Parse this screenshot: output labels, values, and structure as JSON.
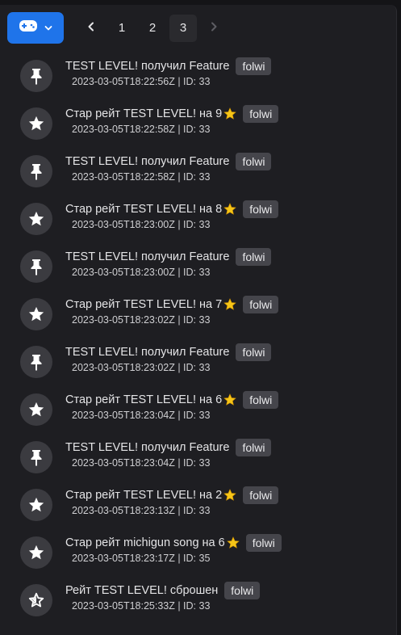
{
  "toolbar": {
    "game_icon": "gamepad-icon",
    "dropdown_icon": "chevron-down-icon",
    "accent": "#1f74ea"
  },
  "pagination": {
    "prev_icon": "chevron-left-icon",
    "next_icon": "chevron-right-icon",
    "pages": [
      "1",
      "2",
      "3"
    ],
    "current": "3"
  },
  "events": [
    {
      "kind": "feature",
      "icon": "pin-icon",
      "message": "TEST LEVEL! получил Feature",
      "star": false,
      "user": "folwi",
      "meta": "2023-03-05T18:22:56Z | ID: 33"
    },
    {
      "kind": "rate",
      "icon": "star-icon",
      "message": "Стар рейт TEST LEVEL! на 9",
      "star": true,
      "user": "folwi",
      "meta": "2023-03-05T18:22:58Z | ID: 33"
    },
    {
      "kind": "feature",
      "icon": "pin-icon",
      "message": "TEST LEVEL! получил Feature",
      "star": false,
      "user": "folwi",
      "meta": "2023-03-05T18:22:58Z | ID: 33"
    },
    {
      "kind": "rate",
      "icon": "star-icon",
      "message": "Стар рейт TEST LEVEL! на 8",
      "star": true,
      "user": "folwi",
      "meta": "2023-03-05T18:23:00Z | ID: 33"
    },
    {
      "kind": "feature",
      "icon": "pin-icon",
      "message": "TEST LEVEL! получил Feature",
      "star": false,
      "user": "folwi",
      "meta": "2023-03-05T18:23:00Z | ID: 33"
    },
    {
      "kind": "rate",
      "icon": "star-icon",
      "message": "Стар рейт TEST LEVEL! на 7",
      "star": true,
      "user": "folwi",
      "meta": "2023-03-05T18:23:02Z | ID: 33"
    },
    {
      "kind": "feature",
      "icon": "pin-icon",
      "message": "TEST LEVEL! получил Feature",
      "star": false,
      "user": "folwi",
      "meta": "2023-03-05T18:23:02Z | ID: 33"
    },
    {
      "kind": "rate",
      "icon": "star-icon",
      "message": "Стар рейт TEST LEVEL! на 6",
      "star": true,
      "user": "folwi",
      "meta": "2023-03-05T18:23:04Z | ID: 33"
    },
    {
      "kind": "feature",
      "icon": "pin-icon",
      "message": "TEST LEVEL! получил Feature",
      "star": false,
      "user": "folwi",
      "meta": "2023-03-05T18:23:04Z | ID: 33"
    },
    {
      "kind": "rate",
      "icon": "star-icon",
      "message": "Стар рейт TEST LEVEL! на 2",
      "star": true,
      "user": "folwi",
      "meta": "2023-03-05T18:23:13Z | ID: 33"
    },
    {
      "kind": "rate",
      "icon": "star-icon",
      "message": "Стар рейт michigun song на 6",
      "star": true,
      "user": "folwi",
      "meta": "2023-03-05T18:23:17Z | ID: 35"
    },
    {
      "kind": "reset",
      "icon": "star-outline-icon",
      "message": "Рейт TEST LEVEL! сброшен",
      "star": false,
      "user": "folwi",
      "meta": "2023-03-05T18:25:33Z | ID: 33"
    }
  ],
  "colors": {
    "panel_bg": "#1e1e22",
    "avatar_bg": "#3b3b40",
    "badge_bg": "#45454b",
    "star_emoji": "#f5c518"
  }
}
